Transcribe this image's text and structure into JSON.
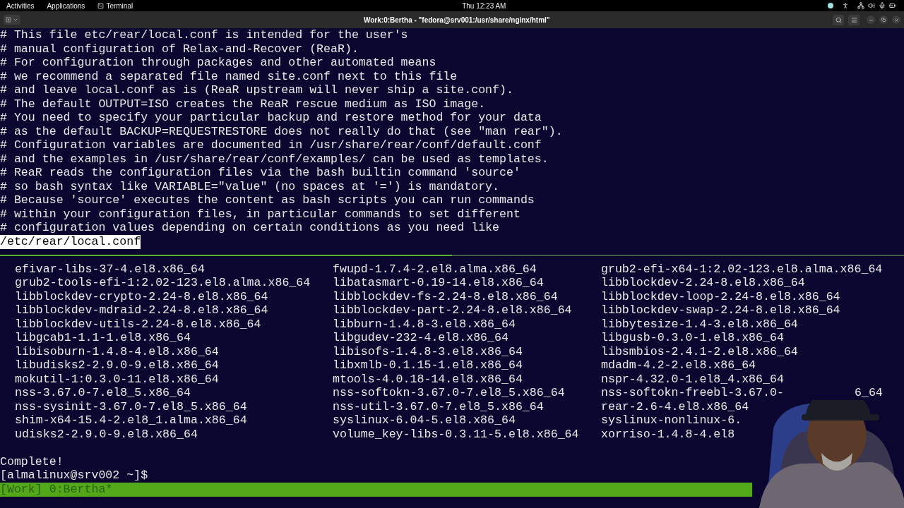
{
  "top_bar": {
    "activities": "Activities",
    "applications": "Applications",
    "app_name": "Terminal",
    "clock": "Thu 12:23 AM"
  },
  "window": {
    "title": "Work:0:Bertha - \"fedora@srv001:/usr/share/nginx/html\""
  },
  "upper_pane": {
    "lines": [
      "# This file etc/rear/local.conf is intended for the user's",
      "# manual configuration of Relax-and-Recover (ReaR).",
      "# For configuration through packages and other automated means",
      "# we recommend a separated file named site.conf next to this file",
      "# and leave local.conf as is (ReaR upstream will never ship a site.conf).",
      "# The default OUTPUT=ISO creates the ReaR rescue medium as ISO image.",
      "# You need to specify your particular backup and restore method for your data",
      "# as the default BACKUP=REQUESTRESTORE does not really do that (see \"man rear\").",
      "# Configuration variables are documented in /usr/share/rear/conf/default.conf",
      "# and the examples in /usr/share/rear/conf/examples/ can be used as templates.",
      "# ReaR reads the configuration files via the bash builtin command 'source'",
      "# so bash syntax like VARIABLE=\"value\" (no spaces at '=') is mandatory.",
      "# Because 'source' executes the content as bash scripts you can run commands",
      "# within your configuration files, in particular commands to set different",
      "# configuration values depending on certain conditions as you need like"
    ],
    "file_path": "/etc/rear/local.conf"
  },
  "lower_pane": {
    "rows": [
      {
        "cells": [
          "efivar-libs-37-4.el8.x86_64",
          "fwupd-1.7.4-2.el8.alma.x86_64",
          "grub2-efi-x64-1:2.02-123.el8.alma.x86_64"
        ]
      },
      {
        "cells": [
          "grub2-tools-efi-1:2.02-123.el8.alma.x86_64",
          "libatasmart-0.19-14.el8.x86_64",
          "libblockdev-2.24-8.el8.x86_64"
        ]
      },
      {
        "cells": [
          "libblockdev-crypto-2.24-8.el8.x86_64",
          "libblockdev-fs-2.24-8.el8.x86_64",
          "libblockdev-loop-2.24-8.el8.x86_64"
        ]
      },
      {
        "cells": [
          "libblockdev-mdraid-2.24-8.el8.x86_64",
          "libblockdev-part-2.24-8.el8.x86_64",
          "libblockdev-swap-2.24-8.el8.x86_64"
        ]
      },
      {
        "cells": [
          "libblockdev-utils-2.24-8.el8.x86_64",
          "libburn-1.4.8-3.el8.x86_64",
          "libbytesize-1.4-3.el8.x86_64"
        ]
      },
      {
        "cells": [
          "libgcab1-1.1-1.el8.x86_64",
          "libgudev-232-4.el8.x86_64",
          "libgusb-0.3.0-1.el8.x86_64"
        ]
      },
      {
        "cells": [
          "libisoburn-1.4.8-4.el8.x86_64",
          "libisofs-1.4.8-3.el8.x86_64",
          "libsmbios-2.4.1-2.el8.x86_64"
        ]
      },
      {
        "cells": [
          "libudisks2-2.9.0-9.el8.x86_64",
          "libxmlb-0.1.15-1.el8.x86_64",
          "mdadm-4.2-2.el8.x86_64"
        ]
      },
      {
        "cells": [
          "mokutil-1:0.3.0-11.el8.x86_64",
          "mtools-4.0.18-14.el8.x86_64",
          "nspr-4.32.0-1.el8_4.x86_64"
        ]
      },
      {
        "cells": [
          "nss-3.67.0-7.el8_5.x86_64",
          "nss-softokn-3.67.0-7.el8_5.x86_64",
          "nss-softokn-freebl-3.67.0-"
        ],
        "tail": "6_64"
      },
      {
        "cells": [
          "nss-sysinit-3.67.0-7.el8_5.x86_64",
          "nss-util-3.67.0-7.el8_5.x86_64",
          "rear-2.6-4.el8.x86_64"
        ]
      },
      {
        "cells": [
          "shim-x64-15.4-2.el8_1.alma.x86_64",
          "syslinux-6.04-5.el8.x86_64",
          "syslinux-nonlinux-6."
        ]
      },
      {
        "cells": [
          "udisks2-2.9.0-9.el8.x86_64",
          "volume_key-libs-0.3.11-5.el8.x86_64",
          "xorriso-1.4.8-4.el8"
        ]
      }
    ],
    "complete": "Complete!",
    "prompt": "[almalinux@srv002 ~]$"
  },
  "status_bar": {
    "text": "[Work] 0:Bertha*"
  }
}
